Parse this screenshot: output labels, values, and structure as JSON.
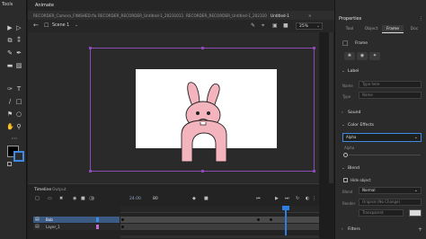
{
  "tools_panel": {
    "title": "Tools"
  },
  "document_tabs": {
    "app_title": "Animate",
    "tabs": [
      "Untitled-1",
      "RECORDER_Camera_FINISHED.fla",
      "RECORDER_RECORDER_Untitled-1_2023101110146.fla (Episode)",
      "RECORDER_RECORDER_Untitled-1_2023101110146.fla",
      "Untitled-1"
    ]
  },
  "scene_bar": {
    "scene_name": "Scene 1",
    "zoom": "25%"
  },
  "timeline": {
    "tabs": [
      "Timeline",
      "Output"
    ],
    "fps": "24.00",
    "frame_number": "80",
    "layers": [
      {
        "name": "Bob",
        "selected": true
      },
      {
        "name": "Layer_1",
        "selected": false
      }
    ]
  },
  "properties": {
    "title": "Properties",
    "tabs": [
      "Tool",
      "Object",
      "Frame",
      "Doc"
    ],
    "active_tab": "Frame",
    "frame_label": "Frame",
    "label_section": {
      "title": "Label",
      "name_label": "Name",
      "name_placeholder": "Type here",
      "type_label": "Type",
      "type_value": "Name"
    },
    "sound_section": {
      "title": "Sound"
    },
    "color_effects": {
      "title": "Color Effects",
      "selected": "Alpha",
      "alpha_label": "Alpha",
      "alpha_value": "0"
    },
    "blend_section": {
      "title": "Blend",
      "hide_object": "Hide object",
      "blend_label": "Blend",
      "blend_value": "Normal",
      "render_label": "Render",
      "render_value": "Original (No Change)",
      "bg_label": "Transparent"
    },
    "filters": {
      "title": "Filters"
    }
  },
  "colors": {
    "selection_purple": "#8a4bb5",
    "accent_blue": "#3d8be6",
    "playhead_blue": "#2f7fe0",
    "character_pink": "#f4b4bd"
  }
}
